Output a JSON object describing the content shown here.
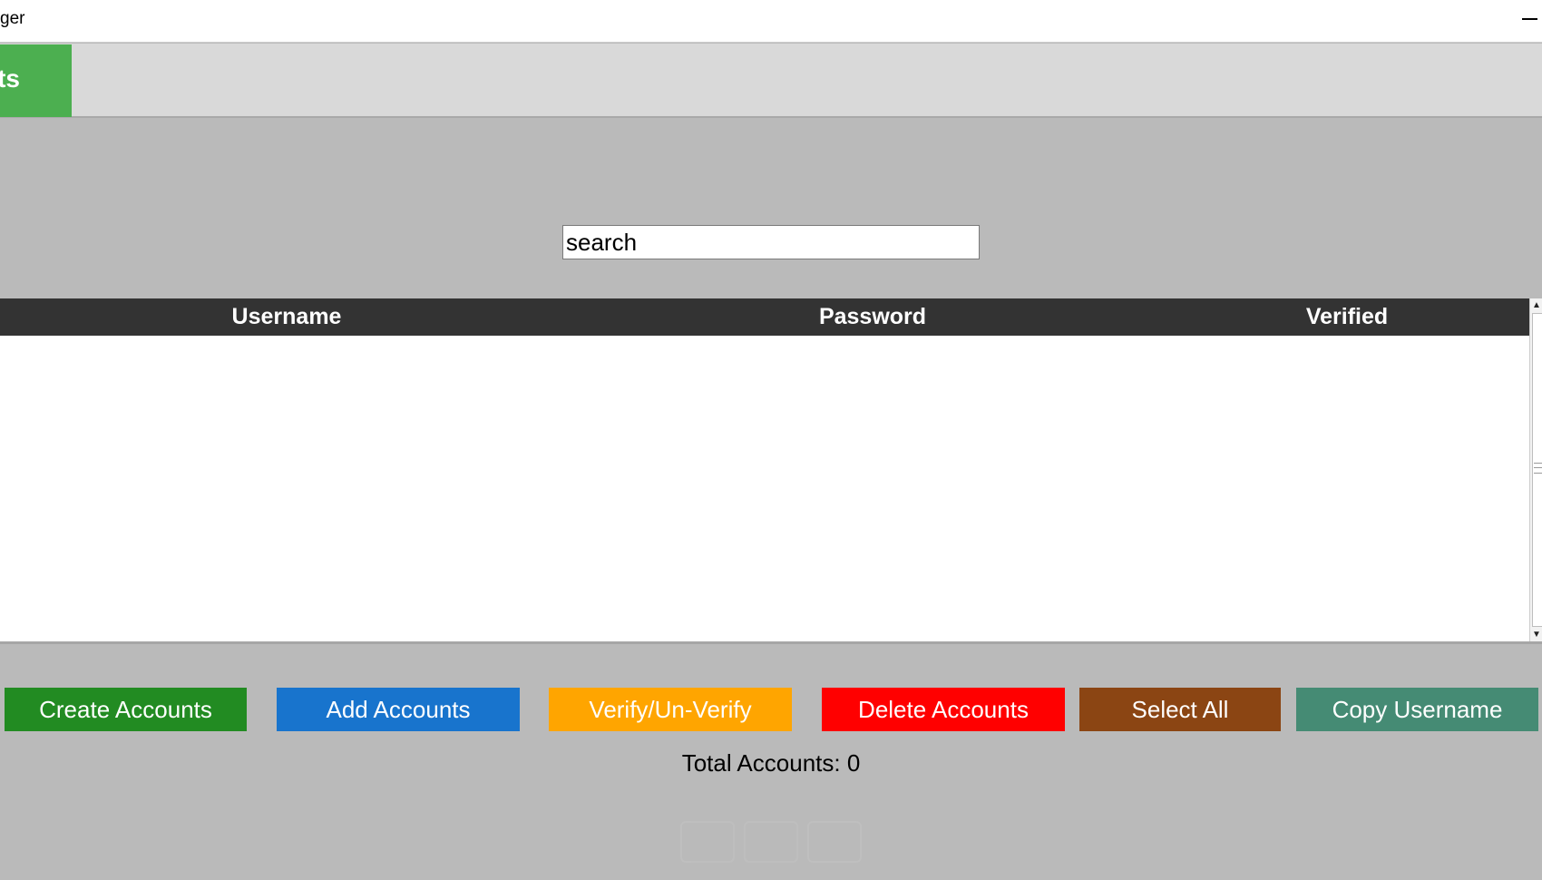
{
  "window": {
    "title": "ger",
    "minimize_label": "—"
  },
  "tabs": {
    "active_label": "ts"
  },
  "search": {
    "value": "search"
  },
  "table": {
    "columns": [
      "Username",
      "Password",
      "Verified"
    ],
    "rows": []
  },
  "scrollbar": {
    "up_arrow": "▲",
    "down_arrow": "▼"
  },
  "buttons": {
    "create": "Create Accounts",
    "add": "Add Accounts",
    "verify": "Verify/Un-Verify",
    "delete": "Delete Accounts",
    "select_all": "Select All",
    "copy_username": "Copy Username"
  },
  "status": {
    "total_accounts": "Total Accounts: 0"
  },
  "colors": {
    "create": "#228b22",
    "add": "#1874cd",
    "verify": "#ffa500",
    "delete": "#ff0000",
    "select_all": "#8b4513",
    "copy_username": "#458b74",
    "active_tab": "#4caf50",
    "table_header": "#333333"
  }
}
